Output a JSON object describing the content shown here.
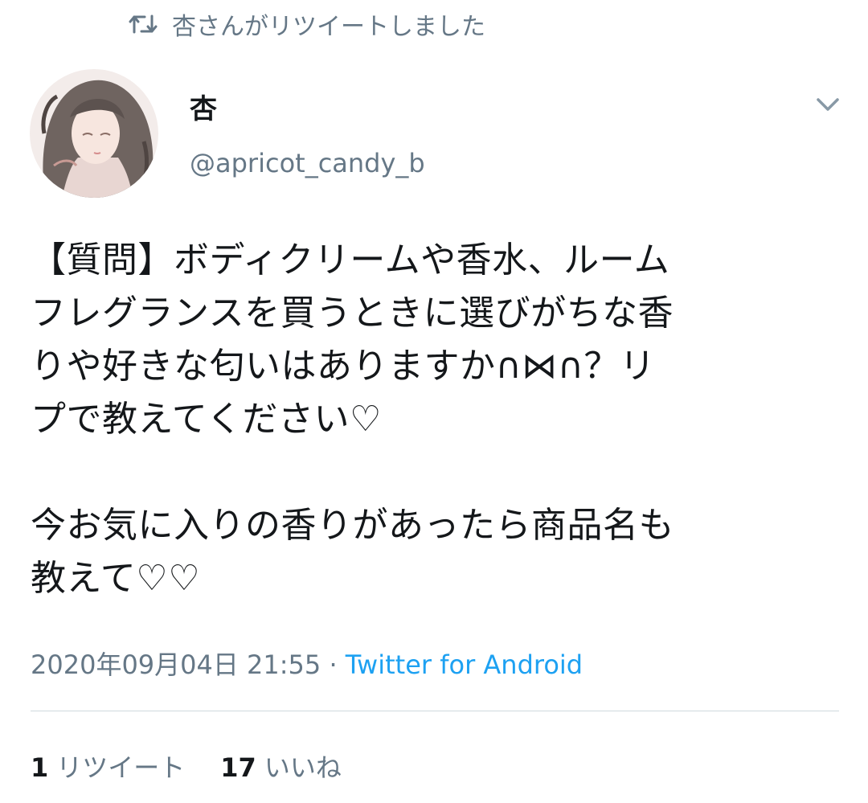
{
  "retweet_context": {
    "icon": "retweet-icon",
    "text": "杏さんがリツイートしました"
  },
  "author": {
    "display_name": "杏",
    "handle": "@apricot_candy_b",
    "avatar_icon": "avatar"
  },
  "menu": {
    "icon": "chevron-down-icon"
  },
  "tweet": {
    "text": "【質問】ボディクリームや香水、ルーム\nフレグランスを買うときに選びがちな香\nりや好きな匂いはありますか∩⋈∩？リ\nプで教えてください♡\n\n今お気に入りの香りがあったら商品名も\n教えて♡♡"
  },
  "meta": {
    "timestamp": "2020年09月04日 21:55",
    "separator": " · ",
    "source": "Twitter for Android"
  },
  "stats": {
    "retweets_count": "1",
    "retweets_label": "リツイート",
    "likes_count": "17",
    "likes_label": "いいね"
  },
  "colors": {
    "text_primary": "#14171a",
    "text_secondary": "#657786",
    "link": "#1da1f2",
    "divider": "#cfd9de"
  }
}
